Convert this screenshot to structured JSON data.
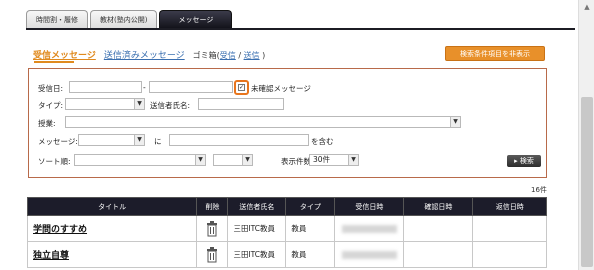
{
  "tabs": [
    {
      "label": "時間割・履修"
    },
    {
      "label": "教材(塾内公開)"
    },
    {
      "label": "メッセージ"
    }
  ],
  "links": {
    "received": "受信メッセージ",
    "sent": "送信済みメッセージ",
    "format_label": "ゴミ箱(",
    "format_received": "受信",
    "format_sep": " / ",
    "format_sent": "送信",
    "format_close": " )"
  },
  "toggle_button": "検索条件項目を非表示",
  "search": {
    "date_label": "受信日:",
    "date_sep": "-",
    "unread_label": "未確認メッセージ",
    "type_label": "タイプ:",
    "sender_label": "送信者氏名:",
    "course_label": "授業:",
    "message_label": "メッセージ:",
    "message_in": "に",
    "message_contains": "を含む",
    "sort_label": "ソート順:",
    "display_label": "表示件数:",
    "display_value": "30件",
    "search_button": "検索"
  },
  "result_count": "16件",
  "table": {
    "headers": [
      "タイトル",
      "削除",
      "送信者氏名",
      "タイプ",
      "受信日時",
      "確認日時",
      "返信日時"
    ],
    "rows": [
      {
        "title": "学問のすすめ",
        "sender": "三田ITC教員",
        "type": "教員"
      },
      {
        "title": "独立自尊",
        "sender": "三田ITC教員",
        "type": "教員"
      }
    ]
  },
  "colors": {
    "accent": "#e8902a",
    "tab_active": "#1c1c24",
    "panel_border": "#b86a4a"
  }
}
